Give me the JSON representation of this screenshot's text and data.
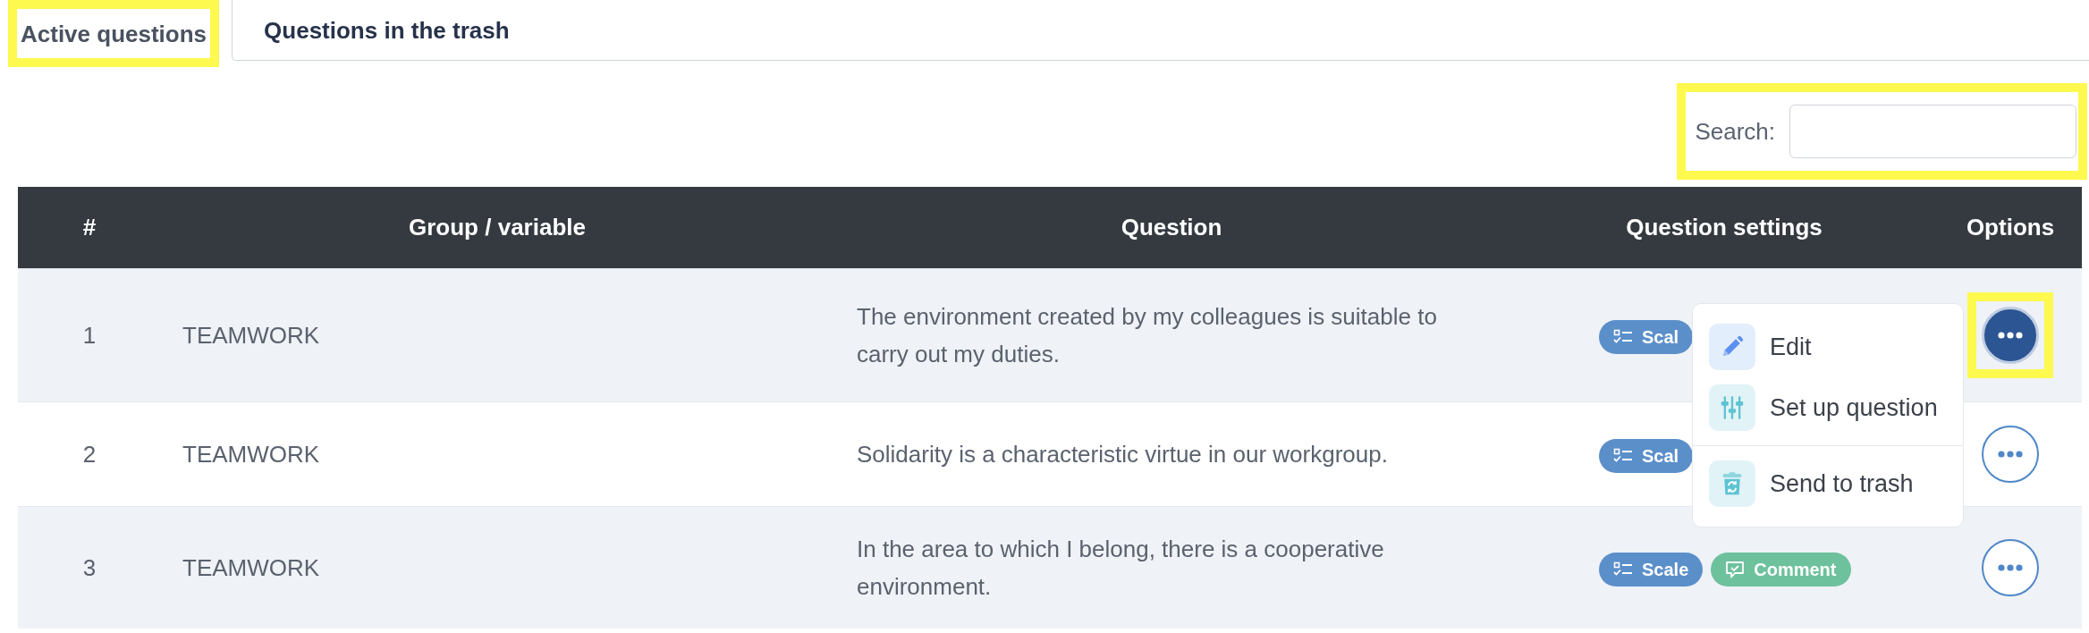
{
  "tabs": [
    {
      "label": "Active questions",
      "selected": true,
      "highlighted": true
    },
    {
      "label": "Questions in the trash",
      "selected": false,
      "highlighted": false
    }
  ],
  "search": {
    "label": "Search:",
    "highlighted": true
  },
  "table": {
    "columns": [
      "#",
      "Group / variable",
      "Question",
      "Question settings",
      "Options"
    ],
    "rows": [
      {
        "number": "1",
        "group": "TEAMWORK",
        "question": "The environment created by my colleagues is suitable to carry out my duties.",
        "settings": [
          {
            "kind": "scale",
            "label": "Scal"
          }
        ],
        "options_open": true,
        "highlighted": true
      },
      {
        "number": "2",
        "group": "TEAMWORK",
        "question": "Solidarity is a characteristic virtue in our workgroup.",
        "settings": [
          {
            "kind": "scale",
            "label": "Scal"
          }
        ],
        "options_open": false,
        "highlighted": false
      },
      {
        "number": "3",
        "group": "TEAMWORK",
        "question": "In the area to which I belong, there is a cooperative environment.",
        "settings": [
          {
            "kind": "scale",
            "label": "Scale"
          },
          {
            "kind": "comment",
            "label": "Comment"
          }
        ],
        "options_open": false,
        "highlighted": false
      }
    ]
  },
  "options_menu": {
    "groups": [
      {
        "items": [
          {
            "kind": "edit",
            "label": "Edit"
          },
          {
            "kind": "setup",
            "label": "Set up question"
          }
        ]
      },
      {
        "items": [
          {
            "kind": "trash",
            "label": "Send to trash"
          }
        ]
      }
    ]
  }
}
